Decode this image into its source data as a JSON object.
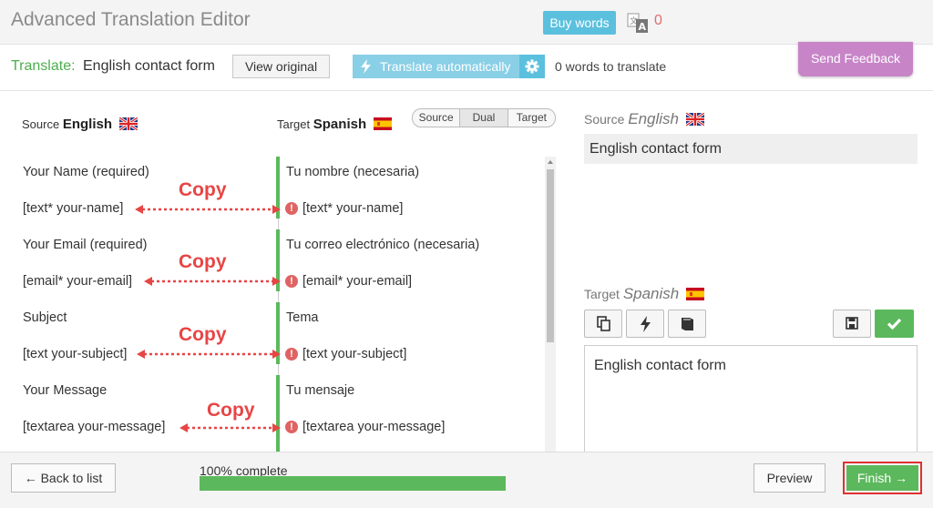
{
  "header": {
    "title": "Advanced Translation Editor",
    "buy_words_label": "Buy words",
    "words_icon": "translate-icon",
    "words_count": "0"
  },
  "toolbar": {
    "translate_label": "Translate:",
    "document_name": "English contact form",
    "view_original_label": "View original",
    "translate_auto_label": "Translate automatically",
    "auto_icon": "bolt-icon",
    "settings_icon": "gear-icon",
    "words_to_translate": "0 words to translate",
    "feedback_label": "Send Feedback"
  },
  "editor": {
    "source_label": "Source",
    "source_language": "English",
    "target_label": "Target",
    "target_language": "Spanish",
    "view_modes": [
      "Source",
      "Dual",
      "Target"
    ],
    "active_view_mode": "Dual",
    "copy_annotation": "Copy",
    "rows": [
      {
        "source": "Your Name (required)",
        "target": "Tu nombre (necesaria)",
        "shortcode": false
      },
      {
        "source": "[text* your-name]",
        "target": "[text* your-name]",
        "shortcode": true
      },
      {
        "source": "Your Email (required)",
        "target": "Tu correo electrónico (necesaria)",
        "shortcode": false
      },
      {
        "source": "[email* your-email]",
        "target": "[email* your-email]",
        "shortcode": true
      },
      {
        "source": "Subject",
        "target": "Tema",
        "shortcode": false
      },
      {
        "source": "[text your-subject]",
        "target": "[text your-subject]",
        "shortcode": true
      },
      {
        "source": "Your Message",
        "target": "Tu mensaje",
        "shortcode": false
      },
      {
        "source": "[textarea your-message]",
        "target": "[textarea your-message]",
        "shortcode": true
      }
    ],
    "error_glyph": "!"
  },
  "detail": {
    "source_label": "Source",
    "source_language": "English",
    "source_text": "English contact form",
    "target_label": "Target",
    "target_language": "Spanish",
    "target_text": "English contact form",
    "tool_icons": [
      "copy-icon",
      "bolt-icon",
      "book-icon",
      "save-icon",
      "check-icon"
    ]
  },
  "footer": {
    "back_label": "← Back to list",
    "progress_label": "100% complete",
    "progress_percent": 100,
    "preview_label": "Preview",
    "finish_label": "Finish →"
  },
  "colors": {
    "accent_green": "#5cb85c",
    "info_blue": "#5bc0de",
    "feedback_purple": "#c785c8",
    "annotation_red": "#e84545"
  }
}
